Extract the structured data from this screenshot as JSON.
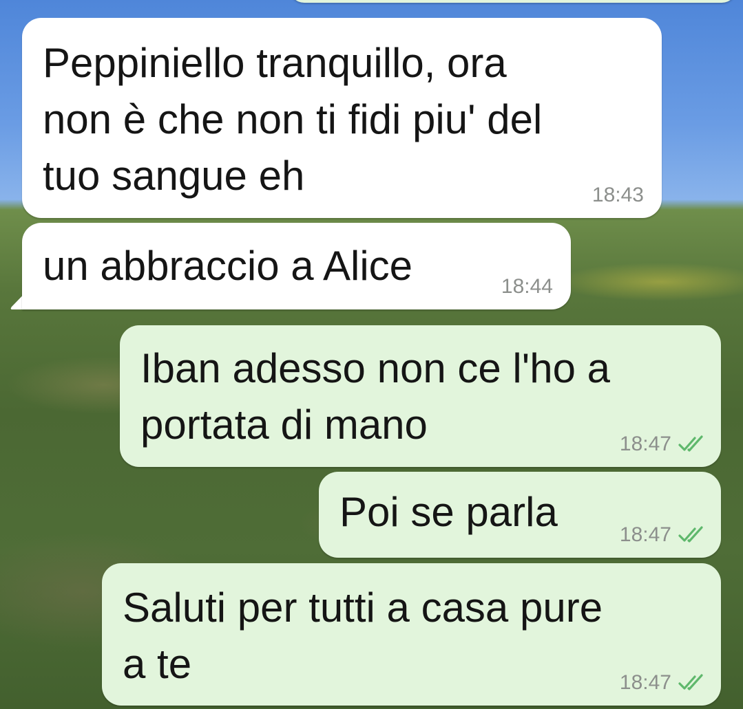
{
  "chat": {
    "messages": [
      {
        "id": "m1",
        "direction": "incoming",
        "text": "Peppiniello tranquillo, ora\nnon è che non ti fidi piu' del\ntuo sangue eh",
        "time": "18:43"
      },
      {
        "id": "m2",
        "direction": "incoming",
        "text": "un abbraccio a Alice",
        "time": "18:44"
      },
      {
        "id": "m3",
        "direction": "outgoing",
        "text": "Iban adesso non ce l'ho a\nportata di mano",
        "time": "18:47",
        "status": "read"
      },
      {
        "id": "m4",
        "direction": "outgoing",
        "text": "Poi se parla",
        "time": "18:47",
        "status": "read"
      },
      {
        "id": "m5",
        "direction": "outgoing",
        "text": "Saluti per tutti a casa pure\na te",
        "time": "18:47",
        "status": "read"
      }
    ]
  },
  "colors": {
    "incoming_bubble": "#ffffff",
    "outgoing_bubble": "#e2f5dc",
    "read_tick": "#5fb86c",
    "timestamp": "#8c8f8c"
  },
  "icons": {
    "read_receipt": "double-check-icon"
  }
}
